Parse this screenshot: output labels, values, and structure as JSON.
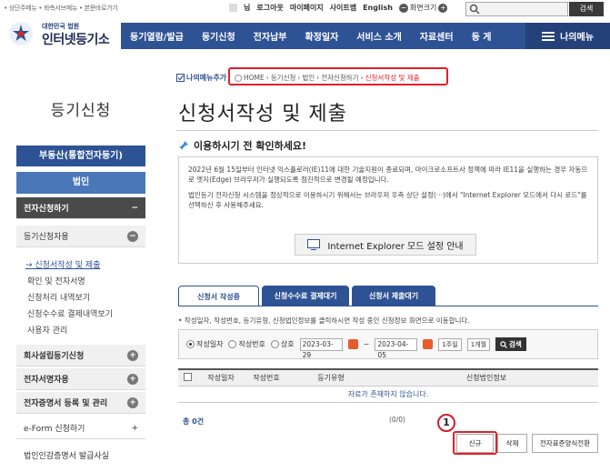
{
  "top": {
    "skip_links": "• 상단주메뉴 • 좌측서브메뉴 • 본문바로가기",
    "util_links": [
      "님",
      "로그아웃",
      "마이페이지",
      "사이트맵",
      "English"
    ],
    "zoom_label": "화면크기",
    "search_button": "검색"
  },
  "logo": {
    "small": "대한민국 법원",
    "main": "인터넷등기소"
  },
  "gnb": {
    "menus": [
      "등기열람/발급",
      "등기신청",
      "전자납부",
      "확정일자",
      "서비스 소개",
      "자료센터",
      "등 게"
    ],
    "my_menu": "나의메뉴"
  },
  "sidebar": {
    "title": "등기신청",
    "realestate": "부동산(통합전자등기)",
    "corporation": "법인",
    "items": [
      {
        "label": "전자신청하기",
        "icon": "−"
      },
      {
        "label": "등기신청자용",
        "icon": "−"
      }
    ],
    "sub_items": [
      "→ 신청서작성 및 제출",
      "확인 및 전자서명",
      "신청처리 내역보기",
      "신청수수료 결제내역보기",
      "사용자 관리"
    ],
    "lower_items": [
      {
        "label": "회사설립등기신청",
        "icon": "+"
      },
      {
        "label": "전자서명자용",
        "icon": "+"
      },
      {
        "label": "전자증명서 등록 및 관리",
        "icon": "+"
      },
      {
        "label": "e-Form 신청하기",
        "icon": "+"
      },
      {
        "label": "법인인감증명서 발급사실",
        "icon": ""
      }
    ]
  },
  "breadcrumb": {
    "my_menu_add": "나의메뉴추가",
    "path": [
      "HOME",
      "등기신청",
      "법인",
      "전자신청하기"
    ],
    "current": "신청서작성 및 제출"
  },
  "page_title": "신청서작성 및 제출",
  "notice": {
    "heading": "이용하시기 전 확인하세요!",
    "paragraph1": "2022년 6월 15일부터 인터넷 익스플로러(IE)11에 대한 기술지원이 종료되며, 마이크로소프트사 정책에 따라 IE11을 실행하는 경우 자동으로 엣지(Edge) 브라우저가 실행되도록 점진적으로 변경될 예정입니다.",
    "paragraph2": "법인등기 전자신청 시스템을 정상적으로 이용하시기 위해서는 브라우저 우측 상단 설정(···)에서 \"Internet Explorer 모드에서 다시 로드\"를 선택하신 후 사용해주세요.",
    "ie_button": "Internet Explorer 모드 설정 안내"
  },
  "tabs": [
    "신청서 작성중",
    "신청수수료 결제대기",
    "신청서 제출대기"
  ],
  "hint": "• 작성일자, 작성번호, 등기유형, 신청법인정보를 클릭하시면 작성 중인 신청정보 화면으로 이동합니다.",
  "filter": {
    "radios": [
      "작성일자",
      "작성번호",
      "상호"
    ],
    "date_from": "2023-03-29",
    "date_to": "2023-04-05",
    "tilde": "~",
    "week_btn": "1주일",
    "month_btn": "1개월",
    "search_btn": "검색"
  },
  "table": {
    "headers": [
      "작성일자",
      "작성번호",
      "등기유형",
      "신청법인정보"
    ],
    "empty_message": "자료가 존재하지 않습니다."
  },
  "footer": {
    "total": "총 0건",
    "pager": "(0/0)",
    "step": "1",
    "new_btn": "신규",
    "delete_btn": "삭제",
    "form_btn": "전자표준양식전환"
  }
}
